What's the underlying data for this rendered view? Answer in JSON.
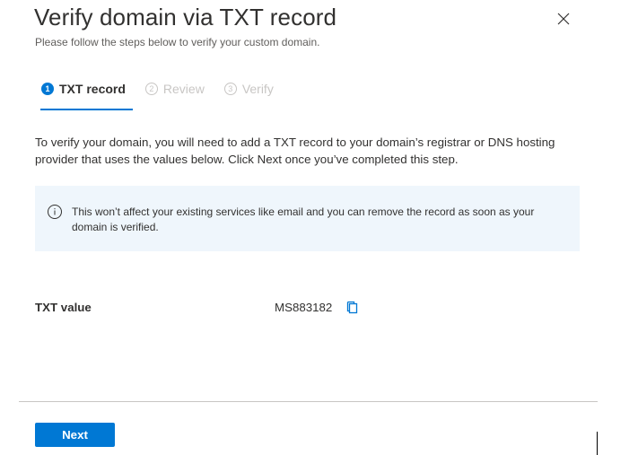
{
  "header": {
    "title": "Verify domain via TXT record",
    "subtitle": "Please follow the steps below to verify your custom domain."
  },
  "steps": [
    {
      "number": "1",
      "label": "TXT record",
      "state": "active"
    },
    {
      "number": "2",
      "label": "Review",
      "state": "inactive"
    },
    {
      "number": "3",
      "label": "Verify",
      "state": "inactive"
    }
  ],
  "main": {
    "description": "To verify your domain, you will need to add a TXT record to your domain’s registrar or DNS hosting provider that uses the values below. Click Next once you’ve completed this step.",
    "info_message": "This won’t affect your existing services like email and you can remove the record as soon as your domain is verified.",
    "txt_label": "TXT value",
    "txt_value": "MS883182"
  },
  "footer": {
    "next_label": "Next"
  },
  "icons": {
    "close": "close-icon",
    "info": "info-icon",
    "copy": "copy-icon"
  },
  "colors": {
    "accent": "#0078d4",
    "info_background": "#eff6fc",
    "inactive_text": "#c8c6c4"
  }
}
